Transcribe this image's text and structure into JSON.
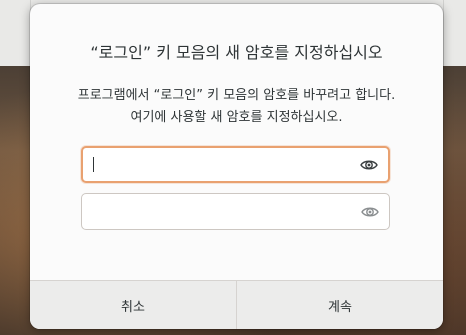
{
  "dialog": {
    "title": "“로그인” 키 모음의 새 암호를 지정하십시오",
    "message": "프로그램에서 “로그인” 키 모음의 암호를 바꾸려고 합니다. 여기에 사용할 새 암호를 지정하십시오.",
    "password_field": {
      "value": "",
      "placeholder": "",
      "icon": "eye-icon"
    },
    "confirm_field": {
      "value": "",
      "placeholder": "",
      "icon": "eye-icon"
    },
    "cancel_label": "취소",
    "continue_label": "계속"
  },
  "colors": {
    "focus_border": "#e9a170",
    "dialog_bg": "#fbfbfb",
    "button_bar_bg": "#ececeb",
    "text": "#2e3436"
  }
}
